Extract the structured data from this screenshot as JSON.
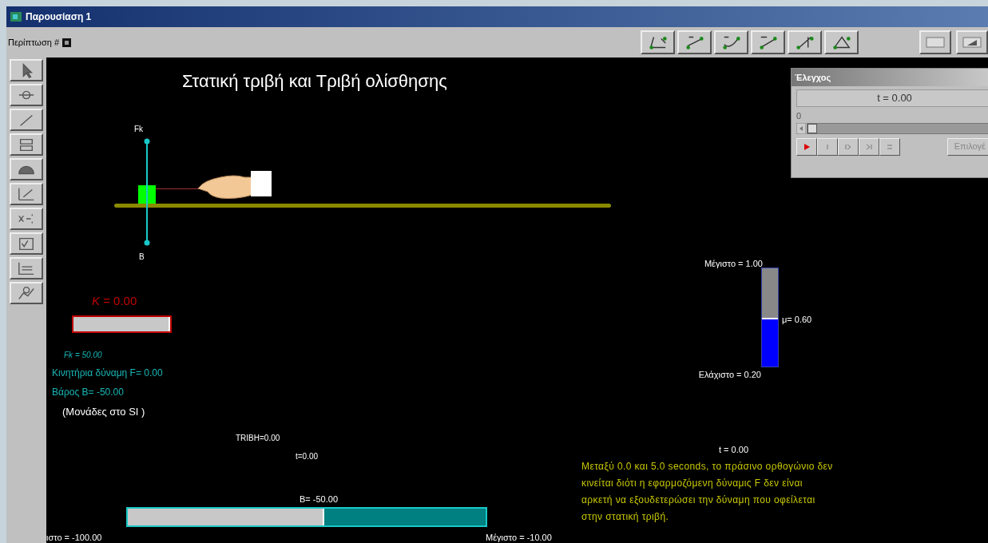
{
  "window": {
    "title": "Παρουσίαση 1"
  },
  "toolbar": {
    "case_label": "Περίπτωση #"
  },
  "canvas": {
    "title": "Στατική τριβή και Τριβή ολίσθησης",
    "force_labels": {
      "top": "Fk",
      "bottom": "B"
    },
    "k_meter": {
      "label": "*K* = 0.00",
      "level": 1
    },
    "readouts": [
      {
        "text": "Fk = 50.00",
        "kind": "small"
      },
      {
        "text": "Κινητήρια δύναμη F= 0.00",
        "kind": "medium"
      },
      {
        "text": "Βάρος Β= -50.00",
        "kind": "medium"
      },
      {
        "text": "(Μονάδες στο SI )",
        "kind": "note"
      }
    ],
    "tribh": "TRIBH=0.00",
    "t_small": "t=0.00",
    "weight_slider": {
      "value_label": "B= -50.00",
      "min_label": "ιστο = -100.00",
      "max_label": "Μέγιστο = -10.00",
      "level": 0.55
    },
    "mu_slider": {
      "max_label": "Μέγιστο = 1.00",
      "value_label": "μ= 0.60",
      "min_label": "Ελάχιστο = 0.20",
      "level": 0.5
    },
    "time_label": "t = 0.00",
    "note": "Μεταξύ  0.0 και 5.0 seconds, το πράσινο ορθογώνιο δεν κινείται διότι η εφαρμοζόμενη δύναμις F δεν είναι αρκετή να εξουδετερώσει την δύναμη που οφείλεται στην στατική τριβή."
  },
  "control_panel": {
    "title": "Έλεγχος",
    "time": "t =  0.00",
    "frame": "0",
    "level": 0,
    "options_button": "Επιλογέ"
  }
}
